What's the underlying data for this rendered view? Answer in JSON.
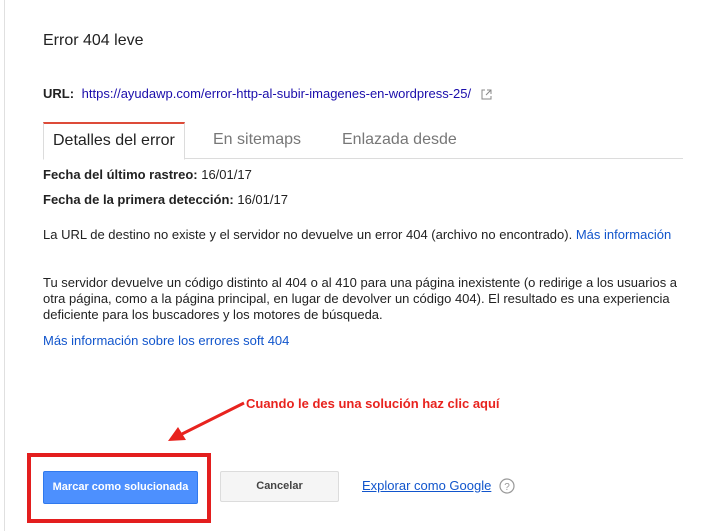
{
  "dialog": {
    "title": "Error 404 leve",
    "url_label": "URL:",
    "url_value": "https://ayudawp.com/error-http-al-subir-imagenes-en-wordpress-25/",
    "url_icon": "external-link-icon"
  },
  "tabs": [
    {
      "label": "Detalles del error",
      "active": true
    },
    {
      "label": "En sitemaps",
      "active": false
    },
    {
      "label": "Enlazada desde",
      "active": false
    }
  ],
  "details": {
    "last_crawl_label": "Fecha del último rastreo:",
    "last_crawl_value": "16/01/17",
    "first_detect_label": "Fecha de la primera detección:",
    "first_detect_value": "16/01/17",
    "paragraph1": "La URL de destino no existe y el servidor no devuelve un error 404 (archivo no encontrado).",
    "paragraph1_link": "Más información",
    "paragraph2": "Tu servidor devuelve un código distinto al 404 o al 410 para una página inexistente (o redirige a los usuarios a otra página, como a la página principal, en lugar de devolver un código 404). El resultado es una experiencia deficiente para los buscadores y los motores de búsqueda.",
    "soft404_link": "Más información sobre los errores soft 404"
  },
  "annotation": {
    "text": "Cuando le des una solución haz clic aquí",
    "color": "#e8231e"
  },
  "actions": {
    "primary_label": "Marcar como solucionada",
    "secondary_label": "Cancelar",
    "explore_label": "Explorar como Google",
    "help_icon": "help-circle-icon"
  },
  "colors": {
    "primary_button": "#4d90fe",
    "link": "#1155cc",
    "url_link": "#1a0dab",
    "active_tab_accent": "#dd4b39",
    "highlight": "#e31e1e"
  }
}
